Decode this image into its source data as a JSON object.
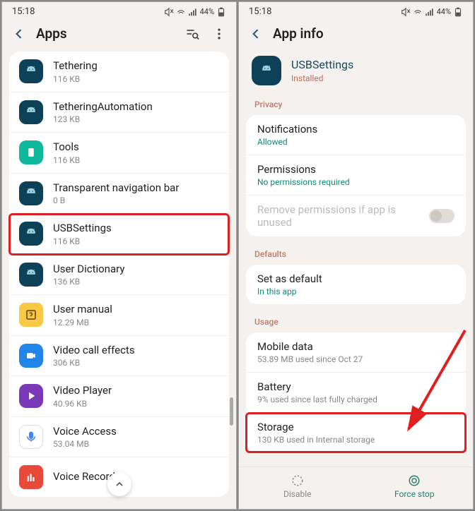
{
  "left": {
    "status": {
      "time": "15:18",
      "battery": "44%"
    },
    "header": {
      "title": "Apps"
    },
    "apps": [
      {
        "name": "Tethering",
        "size": "116 KB",
        "iconClass": "navy",
        "icon": "android"
      },
      {
        "name": "TetheringAutomation",
        "size": "123 KB",
        "iconClass": "navy",
        "icon": "android"
      },
      {
        "name": "Tools",
        "size": "116 KB",
        "iconClass": "teal",
        "icon": "doc"
      },
      {
        "name": "Transparent navigation bar",
        "size": "0 B",
        "iconClass": "navy",
        "icon": "android"
      },
      {
        "name": "USBSettings",
        "size": "116 KB",
        "iconClass": "navy",
        "icon": "android",
        "highlighted": true
      },
      {
        "name": "User Dictionary",
        "size": "136 KB",
        "iconClass": "navy",
        "icon": "android"
      },
      {
        "name": "User manual",
        "size": "12.29 MB",
        "iconClass": "yellow",
        "icon": "question"
      },
      {
        "name": "Video call effects",
        "size": "306 KB",
        "iconClass": "blue",
        "icon": "camera"
      },
      {
        "name": "Video Player",
        "size": "40.96 KB",
        "iconClass": "purple",
        "icon": "play"
      },
      {
        "name": "Voice Access",
        "size": "53.04 MB",
        "iconClass": "white",
        "icon": "mic"
      },
      {
        "name": "Voice Recorder",
        "size": "",
        "iconClass": "red",
        "icon": "bars"
      }
    ]
  },
  "right": {
    "status": {
      "time": "15:18",
      "battery": "44%"
    },
    "header": {
      "title": "App info"
    },
    "app": {
      "name": "USBSettings",
      "status": "Installed"
    },
    "sections": {
      "privacy": {
        "label": "Privacy",
        "notifications": {
          "title": "Notifications",
          "value": "Allowed"
        },
        "permissions": {
          "title": "Permissions",
          "value": "No permissions required"
        },
        "remove": {
          "title": "Remove permissions if app is unused"
        }
      },
      "defaults": {
        "label": "Defaults",
        "setDefault": {
          "title": "Set as default",
          "value": "In this app"
        }
      },
      "usage": {
        "label": "Usage",
        "mobile": {
          "title": "Mobile data",
          "value": "53.89 MB used since Oct 27"
        },
        "battery": {
          "title": "Battery",
          "value": "9% used since last fully charged"
        },
        "storage": {
          "title": "Storage",
          "value": "130 KB used in Internal storage",
          "highlighted": true
        }
      }
    },
    "bottom": {
      "disable": "Disable",
      "forceStop": "Force stop"
    }
  }
}
